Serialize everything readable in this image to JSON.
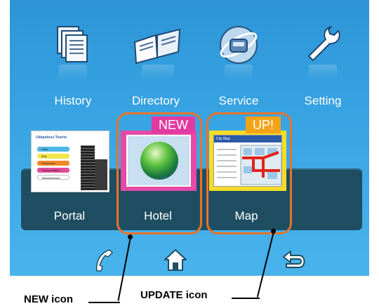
{
  "menu": {
    "items": [
      {
        "label": "History",
        "icon": "history-icon"
      },
      {
        "label": "Directory",
        "icon": "directory-icon"
      },
      {
        "label": "Service",
        "icon": "service-icon"
      },
      {
        "label": "Setting",
        "icon": "setting-icon"
      }
    ]
  },
  "tiles": {
    "portal": {
      "label": "Portal",
      "thumb_title": "Ubiquitous Tourist",
      "thumb_items": [
        "Hotel",
        "Map",
        "Restaurant",
        "Transportation",
        "Miscellaneous"
      ]
    },
    "hotel": {
      "label": "Hotel",
      "badge": "NEW"
    },
    "map": {
      "label": "Map",
      "badge": "UP!",
      "thumb_title": "City Map"
    }
  },
  "nav": {
    "call_icon": "phone-icon",
    "home_icon": "home-icon",
    "back_icon": "back-icon"
  },
  "callouts": {
    "new": "NEW icon",
    "update": "UPDATE icon"
  },
  "colors": {
    "screen_bg": "#37a3e2",
    "shelf": "#1f4e63",
    "highlight": "#e8732a",
    "new_badge": "#e23aa0",
    "up_badge": "#f3a318"
  }
}
